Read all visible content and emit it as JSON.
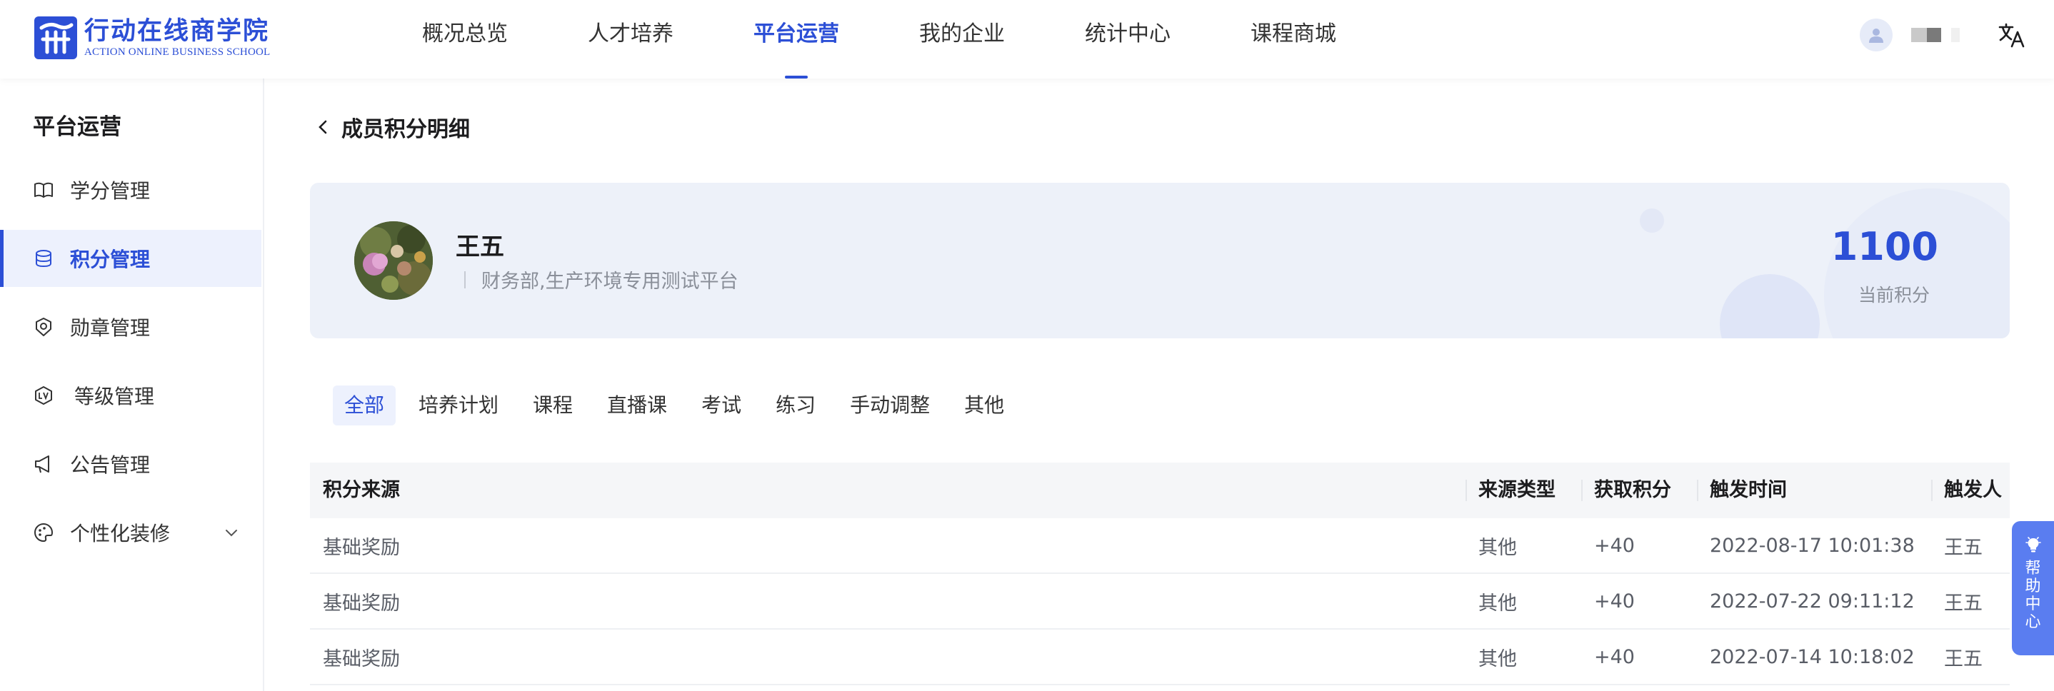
{
  "header": {
    "logo_cn": "行动在线商学院",
    "logo_en": "ACTION ONLINE BUSINESS SCHOOL",
    "nav": [
      {
        "label": "概况总览"
      },
      {
        "label": "人才培养"
      },
      {
        "label": "平台运营",
        "active": true
      },
      {
        "label": "我的企业"
      },
      {
        "label": "统计中心"
      },
      {
        "label": "课程商城"
      }
    ]
  },
  "sidebar": {
    "title": "平台运营",
    "items": [
      {
        "label": "学分管理",
        "icon": "book-icon"
      },
      {
        "label": "积分管理",
        "icon": "database-icon",
        "active": true
      },
      {
        "label": "勋章管理",
        "icon": "medal-icon"
      },
      {
        "label": "等级管理",
        "icon": "level-icon"
      },
      {
        "label": "公告管理",
        "icon": "megaphone-icon"
      },
      {
        "label": "个性化装修",
        "icon": "palette-icon",
        "has_children": true
      }
    ]
  },
  "page": {
    "title": "成员积分明细"
  },
  "profile": {
    "name": "王五",
    "department": "财务部,生产环境专用测试平台",
    "points": "1100",
    "points_label": "当前积分"
  },
  "tabs": [
    {
      "label": "全部",
      "active": true
    },
    {
      "label": "培养计划"
    },
    {
      "label": "课程"
    },
    {
      "label": "直播课"
    },
    {
      "label": "考试"
    },
    {
      "label": "练习"
    },
    {
      "label": "手动调整"
    },
    {
      "label": "其他"
    }
  ],
  "table": {
    "columns": [
      "积分来源",
      "来源类型",
      "获取积分",
      "触发时间",
      "触发人"
    ],
    "rows": [
      [
        "基础奖励",
        "其他",
        "+40",
        "2022-08-17 10:01:38",
        "王五"
      ],
      [
        "基础奖励",
        "其他",
        "+40",
        "2022-07-22 09:11:12",
        "王五"
      ],
      [
        "基础奖励",
        "其他",
        "+40",
        "2022-07-14 10:18:02",
        "王五"
      ]
    ]
  },
  "help": {
    "label": "帮助中心"
  },
  "colors": {
    "accent": "#2c4fd6",
    "active_bg": "#edf1fd",
    "card_bg": "#edf1f9",
    "help_bg": "#5a7df0"
  }
}
